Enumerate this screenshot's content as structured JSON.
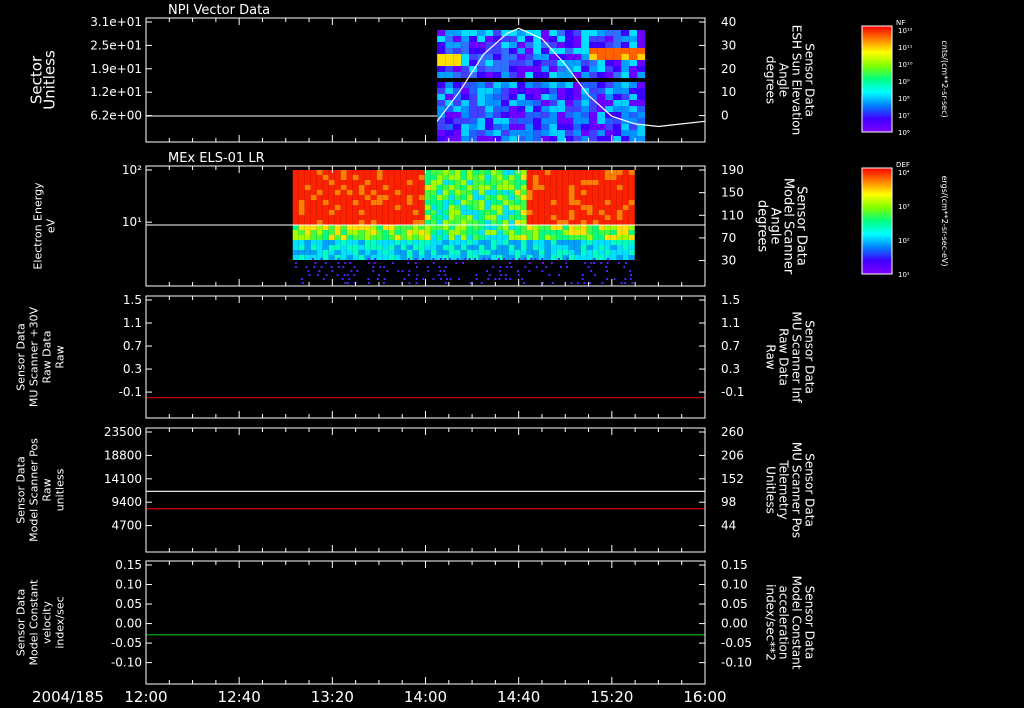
{
  "chart_data": [
    {
      "type": "heatmap",
      "title": "NPI Vector Data",
      "ylabel_left": [
        "Sector",
        "Unitless"
      ],
      "ylabel_right": [
        "Sensor Data",
        "ESH Sun Elevation",
        "Angle",
        "degrees"
      ],
      "left_ticks": [
        "3.1e+01",
        "2.5e+01",
        "1.9e+01",
        "1.2e+01",
        "6.2e+00"
      ],
      "right_ticks": [
        "40",
        "30",
        "20",
        "10",
        "0"
      ],
      "right_ylim": [
        -8,
        40
      ],
      "overlay_curve": {
        "x": [
          "14:05",
          "14:15",
          "14:25",
          "14:35",
          "14:40",
          "14:50",
          "15:00",
          "15:10",
          "15:20",
          "15:30",
          "15:40",
          "15:50",
          "16:00"
        ],
        "y": [
          0,
          12,
          26,
          34,
          36,
          32,
          22,
          10,
          2,
          -1,
          -2,
          -1,
          0
        ]
      },
      "colorbar": {
        "label": "NF",
        "units": "cnts/(cm**2-sr-sec)",
        "ticks": [
          "10¹²",
          "10¹¹",
          "10¹⁰",
          "10⁹",
          "10⁸",
          "10⁷",
          "10⁶"
        ]
      }
    },
    {
      "type": "heatmap",
      "title": "MEx ELS-01 LR",
      "ylabel_left": [
        "Electron Energy",
        "eV"
      ],
      "ylabel_right": [
        "Sensor Data",
        "Model Scanner",
        "Angle",
        "degrees"
      ],
      "left_ticks": [
        "10²",
        "10¹"
      ],
      "right_ticks": [
        "190",
        "150",
        "110",
        "70",
        "30"
      ],
      "right_ylim": [
        0,
        190
      ],
      "colorbar": {
        "label": "DEF",
        "units": "ergs/(cm**2-sr-sec-eV)",
        "ticks": [
          "10⁴",
          "10³",
          "10²",
          "10¹"
        ]
      }
    },
    {
      "type": "line",
      "ylabel_left": [
        "Sensor Data",
        "MU Scanner +30V",
        "Raw Data",
        "Raw"
      ],
      "ylabel_right": [
        "Sensor Data",
        "MU Scanner Inf",
        "Raw Data",
        "Raw"
      ],
      "left_ticks": [
        "1.5",
        "1.1",
        "0.7",
        "0.3",
        "-0.1"
      ],
      "right_ticks": [
        "1.5",
        "1.1",
        "0.7",
        "0.3",
        "-0.1"
      ],
      "ylim": [
        -0.3,
        1.5
      ],
      "series": [
        {
          "color": "#e00000",
          "values": [
            0.0
          ]
        }
      ]
    },
    {
      "type": "line",
      "ylabel_left": [
        "Sensor Data",
        "Model Scanner Pos",
        "Raw",
        "unitless"
      ],
      "ylabel_right": [
        "Sensor Data",
        "MU Scanner Pos",
        "Telemetry",
        "Unitless"
      ],
      "left_ticks": [
        "23500",
        "18800",
        "14100",
        "9400",
        "4700"
      ],
      "right_ticks": [
        "260",
        "206",
        "152",
        "98",
        "44"
      ],
      "ylim": [
        0,
        23500
      ],
      "series": [
        {
          "color": "#ffffff",
          "values": [
            11500
          ]
        },
        {
          "color": "#e00000",
          "values": [
            8200
          ]
        }
      ]
    },
    {
      "type": "line",
      "ylabel_left": [
        "Sensor Data",
        "Model Constant",
        "velocity",
        "index/sec"
      ],
      "ylabel_right": [
        "Sensor Data",
        "Model Constant",
        "acceleration",
        "index/sec**2"
      ],
      "left_ticks": [
        "0.15",
        "0.10",
        "0.05",
        "0.00",
        "-0.05",
        "-0.10"
      ],
      "right_ticks": [
        "0.15",
        "0.10",
        "0.05",
        "0.00",
        "-0.05",
        "-0.10"
      ],
      "ylim": [
        -0.1,
        0.15
      ],
      "series": [
        {
          "color": "#00c000",
          "values": [
            0.0
          ]
        }
      ]
    }
  ],
  "x_axis": {
    "date_label": "2004/185",
    "ticks": [
      "12:00",
      "12:40",
      "13:20",
      "14:00",
      "14:40",
      "15:20",
      "16:00"
    ]
  },
  "colors": {
    "white": "#ffffff",
    "red": "#e00000",
    "green": "#00c000"
  }
}
